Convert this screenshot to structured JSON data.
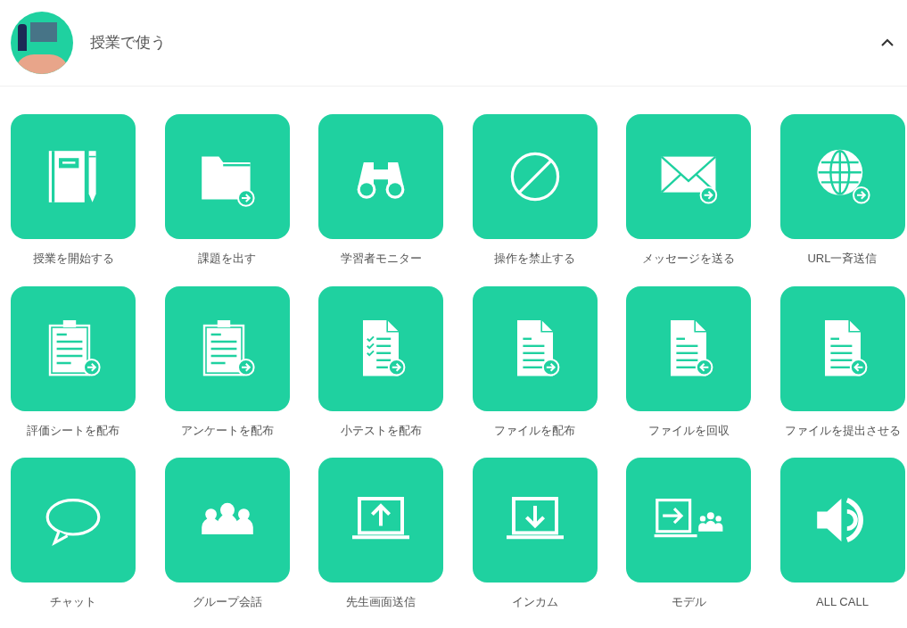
{
  "section": {
    "title": "授業で使う",
    "expanded": true
  },
  "tiles": [
    {
      "label": "授業を開始する",
      "kind": "notebook"
    },
    {
      "label": "課題を出す",
      "kind": "folder-send"
    },
    {
      "label": "学習者モニター",
      "kind": "binoculars"
    },
    {
      "label": "操作を禁止する",
      "kind": "prohibit"
    },
    {
      "label": "メッセージを送る",
      "kind": "mail-send"
    },
    {
      "label": "URL一斉送信",
      "kind": "globe-send"
    },
    {
      "label": "評価シートを配布",
      "kind": "clipboard-send"
    },
    {
      "label": "アンケートを配布",
      "kind": "clipboard-send"
    },
    {
      "label": "小テストを配布",
      "kind": "checklist-send"
    },
    {
      "label": "ファイルを配布",
      "kind": "file-send"
    },
    {
      "label": "ファイルを回収",
      "kind": "file-receive"
    },
    {
      "label": "ファイルを提出させる",
      "kind": "file-receive"
    },
    {
      "label": "チャット",
      "kind": "chat"
    },
    {
      "label": "グループ会話",
      "kind": "group"
    },
    {
      "label": "先生画面送信",
      "kind": "screen-up"
    },
    {
      "label": "インカム",
      "kind": "screen-down"
    },
    {
      "label": "モデル",
      "kind": "model"
    },
    {
      "label": "ALL CALL",
      "kind": "speaker"
    }
  ]
}
